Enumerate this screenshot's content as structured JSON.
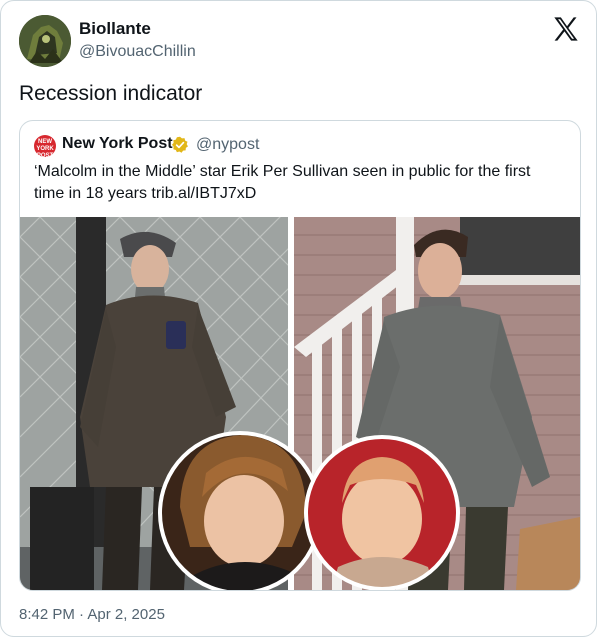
{
  "tweet": {
    "display_name": "Biollante",
    "handle": "@BivouacChillin",
    "text": "Recession indicator",
    "timestamp": "8:42 PM · Apr 2, 2025"
  },
  "quoted_tweet": {
    "logo_text": "NEW YORK POST",
    "display_name": "New York Post",
    "handle": "@nypost",
    "text": "‘Malcolm in the Middle’ star Erik Per Sullivan seen in public for the first time in 18 years trib.al/IBTJ7xD"
  },
  "icons": {
    "brand": "x-logo-icon",
    "verified": "verified-badge-icon"
  },
  "colors": {
    "text_primary": "#0f1419",
    "text_secondary": "#536471",
    "border": "#cfd9de",
    "verified_gold": "#e2b719",
    "nypost_red": "#d7282f"
  }
}
